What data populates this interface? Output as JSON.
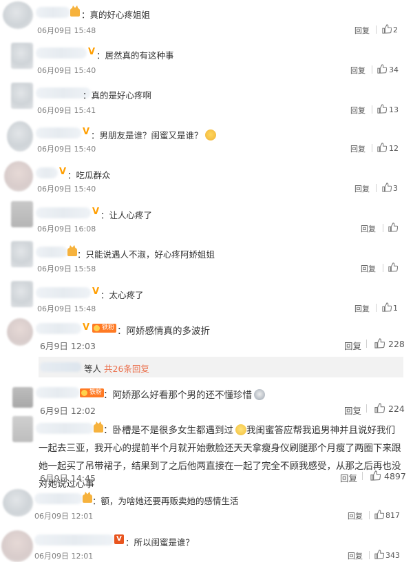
{
  "comments": [
    {
      "text": "真的好心疼姐姐",
      "time": "06月09日 15:48",
      "reply": "回复",
      "likes": "2"
    },
    {
      "text": "居然真的有这种事",
      "time": "06月09日 15:40",
      "reply": "回复",
      "likes": "34"
    },
    {
      "text": "真的是好心疼啊",
      "time": "06月09日 15:41",
      "reply": "回复",
      "likes": "13"
    },
    {
      "text": "男朋友是谁？闺蜜又是谁？",
      "time": "06月09日 15:40",
      "reply": "回复",
      "likes": "12",
      "emoji": "smile-emoji"
    },
    {
      "text": "吃瓜群众",
      "time": "06月09日 15:40",
      "reply": "回复",
      "likes": "3"
    },
    {
      "text": "让人心疼了",
      "time": "06月09日 16:08",
      "reply": "回复",
      "likes": ""
    },
    {
      "text": "只能说遇人不淑，好心疼阿娇姐姐",
      "time": "06月09日 15:58",
      "reply": "回复",
      "likes": ""
    },
    {
      "text": "太心疼了",
      "time": "06月09日 15:48",
      "reply": "回复",
      "likes": "1"
    },
    {
      "badge": "铁粉",
      "text": "阿娇感情真的多波折",
      "time": "6月9日 12:03",
      "reply": "回复",
      "likes": "228"
    },
    {
      "badge": "铁粉",
      "text": "阿娇那么好看那个男的还不懂珍惜",
      "time": "6月9日 12:02",
      "reply": "回复",
      "likes": "224",
      "emoji": "face-emoji"
    },
    {
      "text_part1": "卧槽是不是很多女生都遇到过",
      "text_part2": "我闺蜜答应帮我追男神并且说好我们一起去三亚，我开心的提前半个月就开始敷脸还天天拿瘦身仪刷腿那个月瘦了两圈下来跟她一起买了吊带裙子，结果到了之后他两直接在一起了完全不顾我感受，从那之后再也没对她说过心事",
      "time": "6月9日 14:45",
      "reply": "回复",
      "likes": "4897",
      "emoji": "ok-emoji"
    },
    {
      "text": "额，为啥她还要再贩卖她的感情生活",
      "time": "06月09日 12:01",
      "reply": "回复",
      "likes": "817"
    },
    {
      "text": "所以闺蜜是谁？",
      "time": "06月09日 12:01",
      "reply": "回复",
      "likes": "343"
    }
  ],
  "reply_bar": {
    "prefix": "等人",
    "link": "共26条回复"
  },
  "colors": {
    "accent": "#eb7350",
    "vip": "#ff9e00",
    "fans_badge": "#ff7a24"
  }
}
